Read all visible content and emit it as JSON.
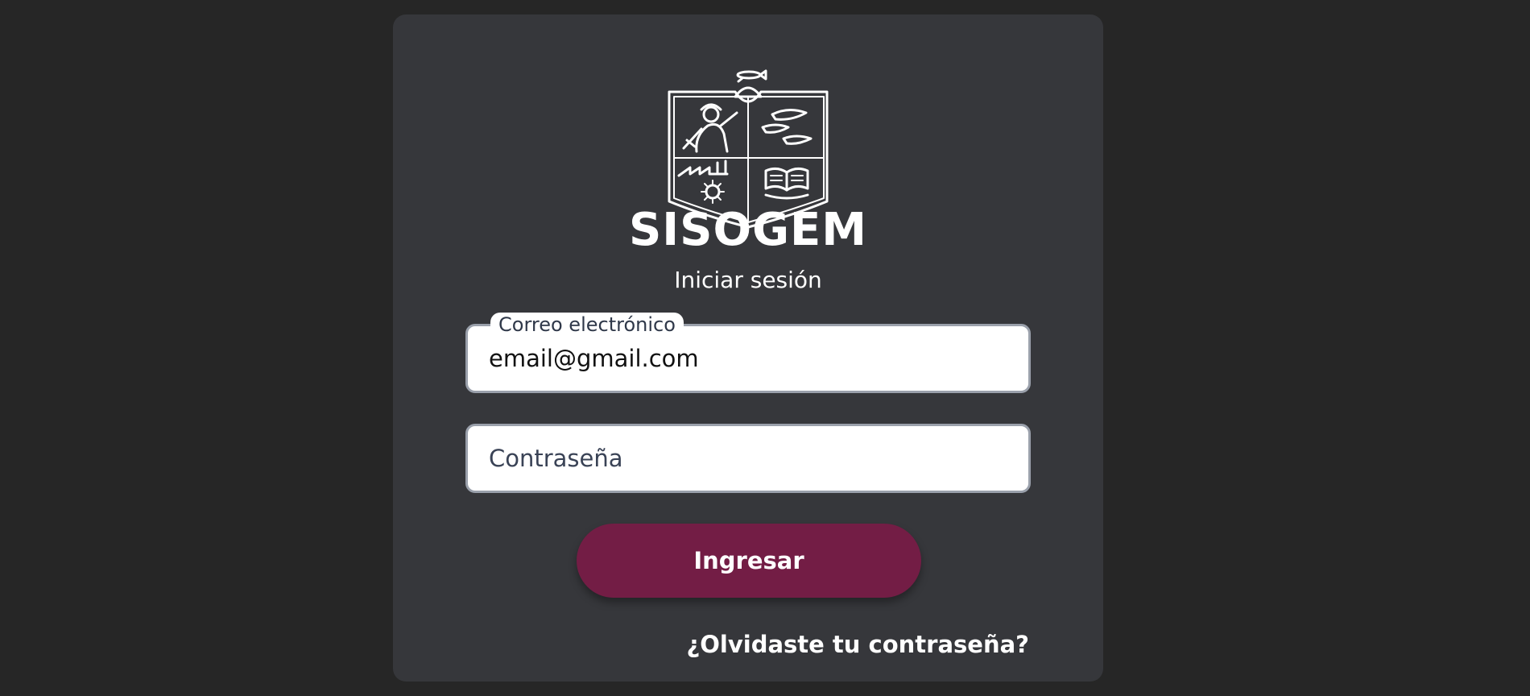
{
  "app": {
    "title": "SISOGEM",
    "subtitle": "Iniciar sesión",
    "logo": "state-coat-of-arms-logo"
  },
  "form": {
    "email": {
      "label": "Correo electrónico",
      "value": "email@gmail.com"
    },
    "password": {
      "placeholder": "Contraseña",
      "value": ""
    },
    "submit_label": "Ingresar",
    "forgot_password_label": "¿Olvidaste tu contraseña?"
  },
  "colors": {
    "page_background": "#262626",
    "card_background": "#36373b",
    "primary_button": "#731d45",
    "text_primary": "#ffffff"
  }
}
